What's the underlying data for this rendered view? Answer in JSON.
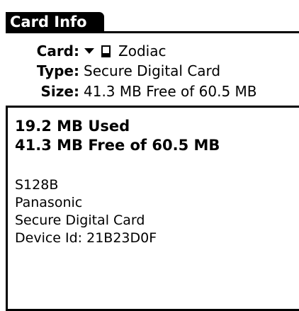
{
  "header": {
    "title": "Card Info"
  },
  "info": {
    "card_label": "Card:",
    "card_value": "Zodiac",
    "type_label": "Type:",
    "type_value": "Secure Digital Card",
    "size_label": "Size:",
    "size_value": "41.3 MB Free of 60.5 MB"
  },
  "details": {
    "used": "19.2 MB Used",
    "free": "41.3 MB Free of 60.5 MB",
    "model": "S128B",
    "manufacturer": "Panasonic",
    "card_type": "Secure Digital Card",
    "device_id": "Device Id: 21B23D0F"
  },
  "icons": {
    "dropdown": "triangle-down-icon",
    "card": "sd-card-icon"
  }
}
